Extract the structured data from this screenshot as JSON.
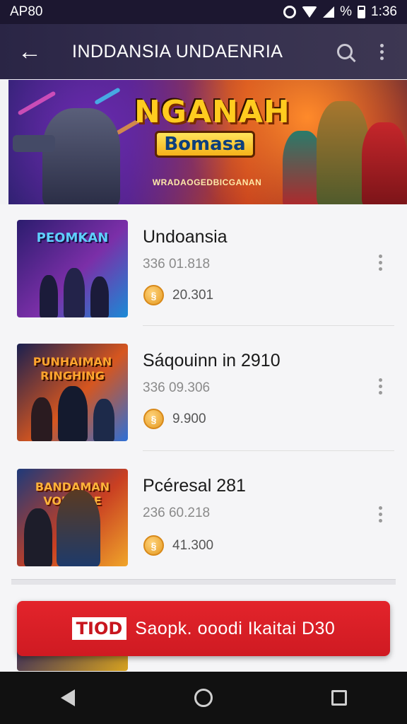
{
  "status_bar": {
    "left_text": "AP80",
    "battery_text": "%",
    "time": "1:36"
  },
  "app_bar": {
    "title": "INDDANSIA UNDAENRIA"
  },
  "banner": {
    "title_top": "NGANAH",
    "title_bottom": "Bomasa",
    "subtitle": "WRADAOGEDBICGANAN"
  },
  "list": {
    "items": [
      {
        "thumb_title": "PEOMKAN",
        "thumb_colors": [
          "#2b1c6e",
          "#7b2fa8",
          "#1a8ad6"
        ],
        "title": "Undoansia",
        "meta": "336 01.818",
        "coin_icon": "coin-icon",
        "value": "20.301"
      },
      {
        "thumb_title": "PUNHAIMAN RINGHING",
        "thumb_colors": [
          "#1a2050",
          "#d6561f",
          "#2d6fd6"
        ],
        "title": "Sáqouinn in 2910",
        "meta": "336 09.306",
        "coin_icon": "coin-icon",
        "value": "9.900"
      },
      {
        "thumb_title": "BANDAMAN VOUINNE",
        "thumb_colors": [
          "#1e3a7a",
          "#c93f22",
          "#f0a52a"
        ],
        "title": "Pcéresal 281",
        "meta": "236 60.218",
        "coin_icon": "coin-icon",
        "value": "41.300"
      }
    ]
  },
  "cta": {
    "badge": "TIOD",
    "label": "Saopk. ooodi Ikaitai D30"
  },
  "colors": {
    "app_bar": "#2a2545",
    "cta": "#e3242b",
    "coin": "#e49a22"
  }
}
